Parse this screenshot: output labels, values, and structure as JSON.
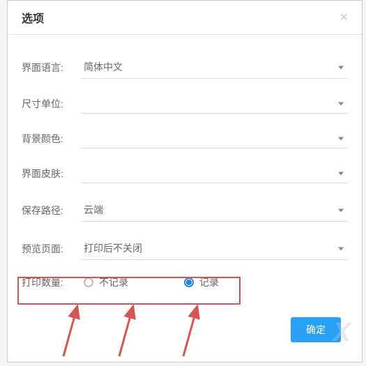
{
  "dialog": {
    "title": "选项",
    "close": "×"
  },
  "form": {
    "language": {
      "label": "界面语言:",
      "value": "简体中文"
    },
    "unit": {
      "label": "尺寸单位:",
      "value": ""
    },
    "bgcolor": {
      "label": "背景颜色:",
      "value": ""
    },
    "skin": {
      "label": "界面皮肤:",
      "value": ""
    },
    "savepath": {
      "label": "保存路径:",
      "value": "云端"
    },
    "preview": {
      "label": "预览页面:",
      "value": "打印后不关闭"
    },
    "printcount": {
      "label": "打印数量:",
      "options": {
        "no_record": "不记录",
        "record": "记录"
      },
      "selected": "record"
    }
  },
  "buttons": {
    "confirm": "确定"
  }
}
